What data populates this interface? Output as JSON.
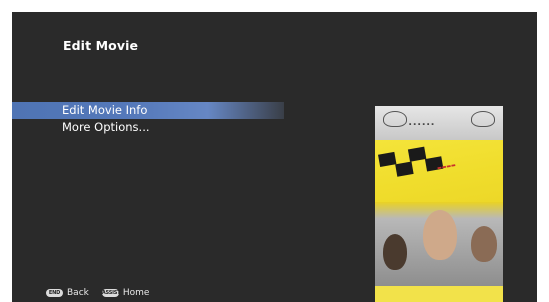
{
  "page": {
    "title": "Edit Movie"
  },
  "menu": {
    "items": [
      {
        "label": "Edit Movie Info",
        "selected": true
      },
      {
        "label": "More Options...",
        "selected": false
      }
    ]
  },
  "footer": {
    "back_key": "END",
    "back_label": "Back",
    "home_key": "ASSIST",
    "home_label": "Home"
  },
  "poster": {
    "icon": "movie-poster-image"
  },
  "colors": {
    "background": "#2a2a2a",
    "selection": "#5579ba",
    "text": "#ffffff"
  }
}
